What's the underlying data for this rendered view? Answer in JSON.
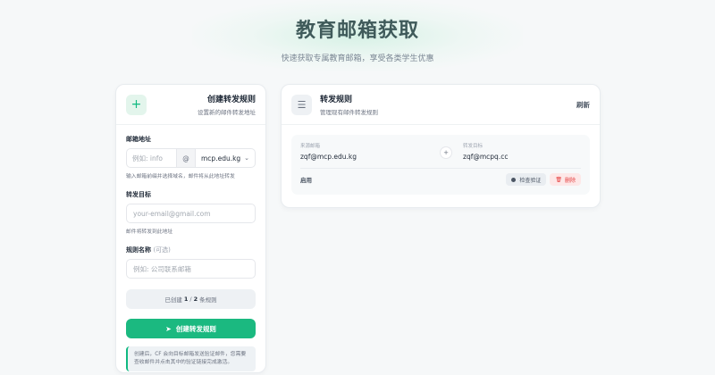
{
  "hero": {
    "title": "教育邮箱获取",
    "subtitle": "快速获取专属教育邮箱，享受各类学生优惠"
  },
  "create_panel": {
    "title": "创建转发规则",
    "subtitle": "设置新的邮件转发地址",
    "email_label": "邮箱地址",
    "email_placeholder": "例如: info",
    "at_symbol": "@",
    "domain_value": "mcp.edu.kg",
    "domain_hint": "输入邮箱前缀并选择域名，邮件将从此地址转发",
    "forward_label": "转发目标",
    "forward_placeholder": "your-email@gmail.com",
    "forward_hint": "邮件将转发到此地址",
    "name_label": "规则名称",
    "name_optional": "(可选)",
    "name_placeholder": "例如: 公司联系邮箱",
    "count_prefix": "已创建",
    "count_current": "1",
    "count_sep": "/",
    "count_max": "2",
    "count_suffix": "条规则",
    "submit_label": "创建转发规则",
    "note": "创建后，CF 会向目标邮箱发送验证邮件，您需要查收邮件并点击其中的验证链接完成激活。"
  },
  "rules_panel": {
    "title": "转发规则",
    "subtitle": "管理现有邮件转发规则",
    "refresh_label": "刷新",
    "rules": [
      {
        "source_label": "来源邮箱",
        "source": "zqf@mcp.edu.kg",
        "target_label": "转发目标",
        "target": "zqf@mcpq.cc",
        "status": "启用",
        "check_label": "检查验证",
        "delete_label": "删除"
      }
    ]
  },
  "colors": {
    "accent": "#1bb980",
    "danger": "#e53e3e"
  },
  "icons": [
    "plus-icon",
    "list-icon",
    "send-icon",
    "trash-icon",
    "chevron-down-icon"
  ]
}
